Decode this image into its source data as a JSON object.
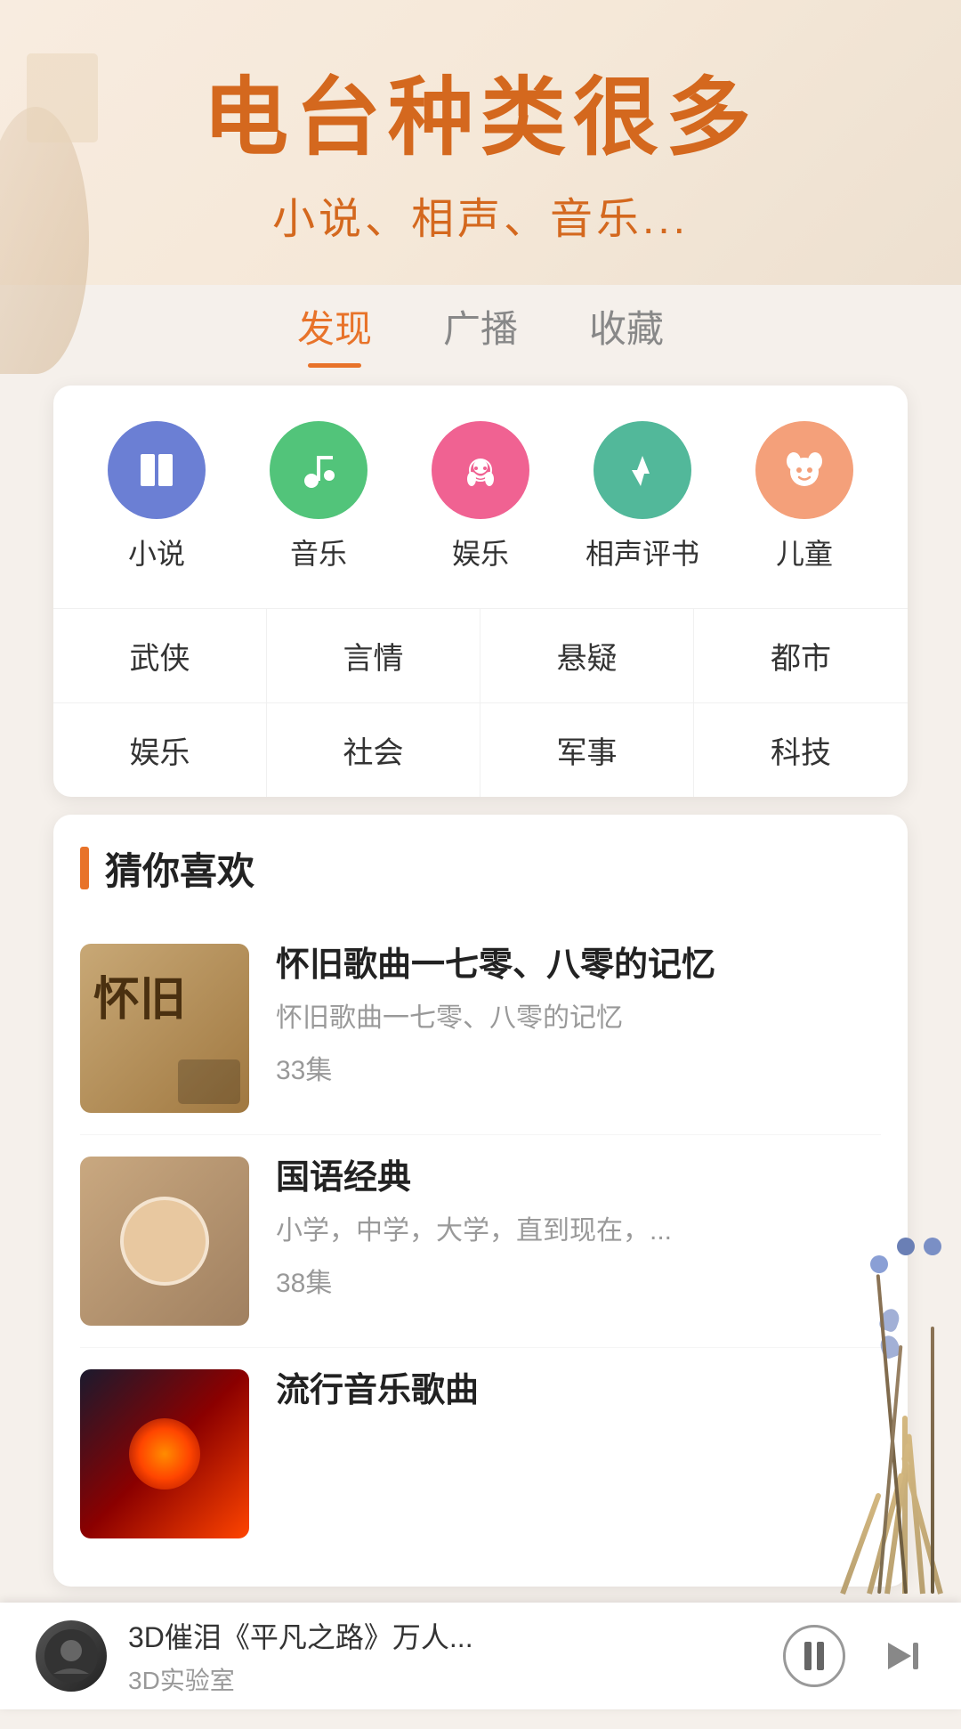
{
  "hero": {
    "title": "电台种类很多",
    "subtitle": "小说、相声、音乐..."
  },
  "tabs": [
    {
      "id": "discover",
      "label": "发现",
      "active": true
    },
    {
      "id": "broadcast",
      "label": "广播",
      "active": false
    },
    {
      "id": "favorites",
      "label": "收藏",
      "active": false
    }
  ],
  "categories": [
    {
      "id": "novel",
      "label": "小说",
      "icon": "📖",
      "color_class": "icon-blue"
    },
    {
      "id": "music",
      "label": "音乐",
      "icon": "🎵",
      "color_class": "icon-green"
    },
    {
      "id": "entertainment",
      "label": "娱乐",
      "icon": "😊",
      "color_class": "icon-pink"
    },
    {
      "id": "crosstalk",
      "label": "相声评书",
      "icon": "🎭",
      "color_class": "icon-teal"
    },
    {
      "id": "children",
      "label": "儿童",
      "icon": "🐼",
      "color_class": "icon-salmon"
    }
  ],
  "genres": [
    {
      "label": "武侠"
    },
    {
      "label": "言情"
    },
    {
      "label": "悬疑"
    },
    {
      "label": "都市"
    },
    {
      "label": "娱乐"
    },
    {
      "label": "社会"
    },
    {
      "label": "军事"
    },
    {
      "label": "科技"
    }
  ],
  "recommend_title": "猜你喜欢",
  "programs": [
    {
      "id": "retro-songs",
      "title": "怀旧歌曲一七零、八零的记忆",
      "desc": "怀旧歌曲一七零、八零的记忆",
      "count": "33集",
      "thumb_type": "retro",
      "thumb_text": "怀旧"
    },
    {
      "id": "mandarin-classics",
      "title": "国语经典",
      "desc": "小学，中学，大学，直到现在，...",
      "count": "38集",
      "thumb_type": "portrait",
      "thumb_text": ""
    },
    {
      "id": "pop-songs",
      "title": "流行音乐歌曲",
      "desc": "",
      "count": "",
      "thumb_type": "action",
      "thumb_text": ""
    }
  ],
  "player": {
    "title": "3D催泪《平凡之路》万人...",
    "subtitle": "3D实验室",
    "is_playing": true
  }
}
